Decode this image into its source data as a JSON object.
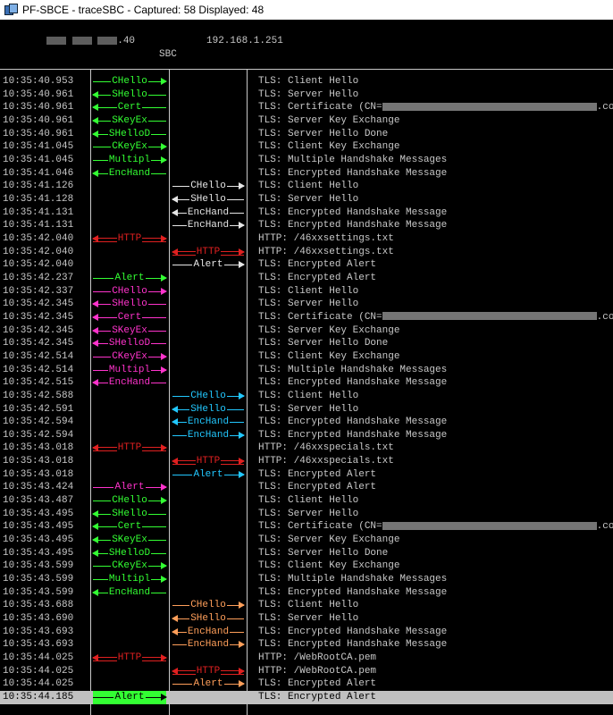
{
  "window": {
    "title": "PF-SBCE - traceSBC - Captured: 58   Displayed: 48"
  },
  "header": {
    "left_ip_suffix": ".40",
    "right_ip": "192.168.1.251",
    "sbc_label": "SBC"
  },
  "colors": {
    "green": "#33ff33",
    "white": "#e6e6e6",
    "red": "#e02020",
    "magenta": "#ff33cc",
    "cyan": "#22c8ff",
    "orange": "#ff9f5a",
    "selected_bg": "#c0c0c0"
  },
  "rows": [
    {
      "ts": "10:35:40.953",
      "label": "CHello",
      "col": "left",
      "dir": "right",
      "color": "green",
      "desc": "TLS: Client Hello"
    },
    {
      "ts": "10:35:40.961",
      "label": "SHello",
      "col": "left",
      "dir": "left",
      "color": "green",
      "desc": "TLS: Server Hello"
    },
    {
      "ts": "10:35:40.961",
      "label": "Cert",
      "col": "left",
      "dir": "left",
      "color": "green",
      "desc": "TLS: Certificate (CN=",
      "desc_suffix": ".com)",
      "redacted": true
    },
    {
      "ts": "10:35:40.961",
      "label": "SKeyEx",
      "col": "left",
      "dir": "left",
      "color": "green",
      "desc": "TLS: Server Key Exchange"
    },
    {
      "ts": "10:35:40.961",
      "label": "SHelloD",
      "col": "left",
      "dir": "left",
      "color": "green",
      "desc": "TLS: Server Hello Done"
    },
    {
      "ts": "10:35:41.045",
      "label": "CKeyEx",
      "col": "left",
      "dir": "right",
      "color": "green",
      "desc": "TLS: Client Key Exchange"
    },
    {
      "ts": "10:35:41.045",
      "label": "Multipl",
      "col": "left",
      "dir": "right",
      "color": "green",
      "desc": "TLS: Multiple Handshake Messages"
    },
    {
      "ts": "10:35:41.046",
      "label": "EncHand",
      "col": "left",
      "dir": "left",
      "color": "green",
      "desc": "TLS: Encrypted Handshake Message"
    },
    {
      "ts": "10:35:41.126",
      "label": "CHello",
      "col": "right",
      "dir": "right",
      "color": "white",
      "desc": "TLS: Client Hello"
    },
    {
      "ts": "10:35:41.128",
      "label": "SHello",
      "col": "right",
      "dir": "left",
      "color": "white",
      "desc": "TLS: Server Hello"
    },
    {
      "ts": "10:35:41.131",
      "label": "EncHand",
      "col": "right",
      "dir": "left",
      "color": "white",
      "desc": "TLS: Encrypted Handshake Message"
    },
    {
      "ts": "10:35:41.131",
      "label": "EncHand",
      "col": "right",
      "dir": "right",
      "color": "white",
      "desc": "TLS: Encrypted Handshake Message"
    },
    {
      "ts": "10:35:42.040",
      "label": "HTTP",
      "col": "left",
      "dir": "both",
      "color": "red",
      "desc": "HTTP: /46xxsettings.txt"
    },
    {
      "ts": "10:35:42.040",
      "label": "HTTP",
      "col": "right",
      "dir": "both",
      "color": "red",
      "desc": "HTTP: /46xxsettings.txt"
    },
    {
      "ts": "10:35:42.040",
      "label": "Alert",
      "col": "right",
      "dir": "right",
      "color": "white",
      "desc": "TLS: Encrypted Alert"
    },
    {
      "ts": "10:35:42.237",
      "label": "Alert",
      "col": "left",
      "dir": "right",
      "color": "green",
      "desc": "TLS: Encrypted Alert"
    },
    {
      "ts": "10:35:42.337",
      "label": "CHello",
      "col": "left",
      "dir": "right",
      "color": "magenta",
      "desc": "TLS: Client Hello"
    },
    {
      "ts": "10:35:42.345",
      "label": "SHello",
      "col": "left",
      "dir": "left",
      "color": "magenta",
      "desc": "TLS: Server Hello"
    },
    {
      "ts": "10:35:42.345",
      "label": "Cert",
      "col": "left",
      "dir": "left",
      "color": "magenta",
      "desc": "TLS: Certificate (CN=",
      "desc_suffix": ".com)",
      "redacted": true
    },
    {
      "ts": "10:35:42.345",
      "label": "SKeyEx",
      "col": "left",
      "dir": "left",
      "color": "magenta",
      "desc": "TLS: Server Key Exchange"
    },
    {
      "ts": "10:35:42.345",
      "label": "SHelloD",
      "col": "left",
      "dir": "left",
      "color": "magenta",
      "desc": "TLS: Server Hello Done"
    },
    {
      "ts": "10:35:42.514",
      "label": "CKeyEx",
      "col": "left",
      "dir": "right",
      "color": "magenta",
      "desc": "TLS: Client Key Exchange"
    },
    {
      "ts": "10:35:42.514",
      "label": "Multipl",
      "col": "left",
      "dir": "right",
      "color": "magenta",
      "desc": "TLS: Multiple Handshake Messages"
    },
    {
      "ts": "10:35:42.515",
      "label": "EncHand",
      "col": "left",
      "dir": "left",
      "color": "magenta",
      "desc": "TLS: Encrypted Handshake Message"
    },
    {
      "ts": "10:35:42.588",
      "label": "CHello",
      "col": "right",
      "dir": "right",
      "color": "cyan",
      "desc": "TLS: Client Hello"
    },
    {
      "ts": "10:35:42.591",
      "label": "SHello",
      "col": "right",
      "dir": "left",
      "color": "cyan",
      "desc": "TLS: Server Hello"
    },
    {
      "ts": "10:35:42.594",
      "label": "EncHand",
      "col": "right",
      "dir": "left",
      "color": "cyan",
      "desc": "TLS: Encrypted Handshake Message"
    },
    {
      "ts": "10:35:42.594",
      "label": "EncHand",
      "col": "right",
      "dir": "right",
      "color": "cyan",
      "desc": "TLS: Encrypted Handshake Message"
    },
    {
      "ts": "10:35:43.018",
      "label": "HTTP",
      "col": "left",
      "dir": "both",
      "color": "red",
      "desc": "HTTP: /46xxspecials.txt"
    },
    {
      "ts": "10:35:43.018",
      "label": "HTTP",
      "col": "right",
      "dir": "both",
      "color": "red",
      "desc": "HTTP: /46xxspecials.txt"
    },
    {
      "ts": "10:35:43.018",
      "label": "Alert",
      "col": "right",
      "dir": "right",
      "color": "cyan",
      "desc": "TLS: Encrypted Alert"
    },
    {
      "ts": "10:35:43.424",
      "label": "Alert",
      "col": "left",
      "dir": "right",
      "color": "magenta",
      "desc": "TLS: Encrypted Alert"
    },
    {
      "ts": "10:35:43.487",
      "label": "CHello",
      "col": "left",
      "dir": "right",
      "color": "green",
      "desc": "TLS: Client Hello"
    },
    {
      "ts": "10:35:43.495",
      "label": "SHello",
      "col": "left",
      "dir": "left",
      "color": "green",
      "desc": "TLS: Server Hello"
    },
    {
      "ts": "10:35:43.495",
      "label": "Cert",
      "col": "left",
      "dir": "left",
      "color": "green",
      "desc": "TLS: Certificate (CN=",
      "desc_suffix": ".com)",
      "redacted": true
    },
    {
      "ts": "10:35:43.495",
      "label": "SKeyEx",
      "col": "left",
      "dir": "left",
      "color": "green",
      "desc": "TLS: Server Key Exchange"
    },
    {
      "ts": "10:35:43.495",
      "label": "SHelloD",
      "col": "left",
      "dir": "left",
      "color": "green",
      "desc": "TLS: Server Hello Done"
    },
    {
      "ts": "10:35:43.599",
      "label": "CKeyEx",
      "col": "left",
      "dir": "right",
      "color": "green",
      "desc": "TLS: Client Key Exchange"
    },
    {
      "ts": "10:35:43.599",
      "label": "Multipl",
      "col": "left",
      "dir": "right",
      "color": "green",
      "desc": "TLS: Multiple Handshake Messages"
    },
    {
      "ts": "10:35:43.599",
      "label": "EncHand",
      "col": "left",
      "dir": "left",
      "color": "green",
      "desc": "TLS: Encrypted Handshake Message"
    },
    {
      "ts": "10:35:43.688",
      "label": "CHello",
      "col": "right",
      "dir": "right",
      "color": "orange",
      "desc": "TLS: Client Hello"
    },
    {
      "ts": "10:35:43.690",
      "label": "SHello",
      "col": "right",
      "dir": "left",
      "color": "orange",
      "desc": "TLS: Server Hello"
    },
    {
      "ts": "10:35:43.693",
      "label": "EncHand",
      "col": "right",
      "dir": "left",
      "color": "orange",
      "desc": "TLS: Encrypted Handshake Message"
    },
    {
      "ts": "10:35:43.693",
      "label": "EncHand",
      "col": "right",
      "dir": "right",
      "color": "orange",
      "desc": "TLS: Encrypted Handshake Message"
    },
    {
      "ts": "10:35:44.025",
      "label": "HTTP",
      "col": "left",
      "dir": "both",
      "color": "red",
      "desc": "HTTP: /WebRootCA.pem"
    },
    {
      "ts": "10:35:44.025",
      "label": "HTTP",
      "col": "right",
      "dir": "both",
      "color": "red",
      "desc": "HTTP: /WebRootCA.pem"
    },
    {
      "ts": "10:35:44.025",
      "label": "Alert",
      "col": "right",
      "dir": "right",
      "color": "orange",
      "desc": "TLS: Encrypted Alert"
    },
    {
      "ts": "10:35:44.185",
      "label": "Alert",
      "col": "left",
      "dir": "right",
      "color": "green",
      "desc": "TLS: Encrypted Alert",
      "selected": true
    }
  ]
}
